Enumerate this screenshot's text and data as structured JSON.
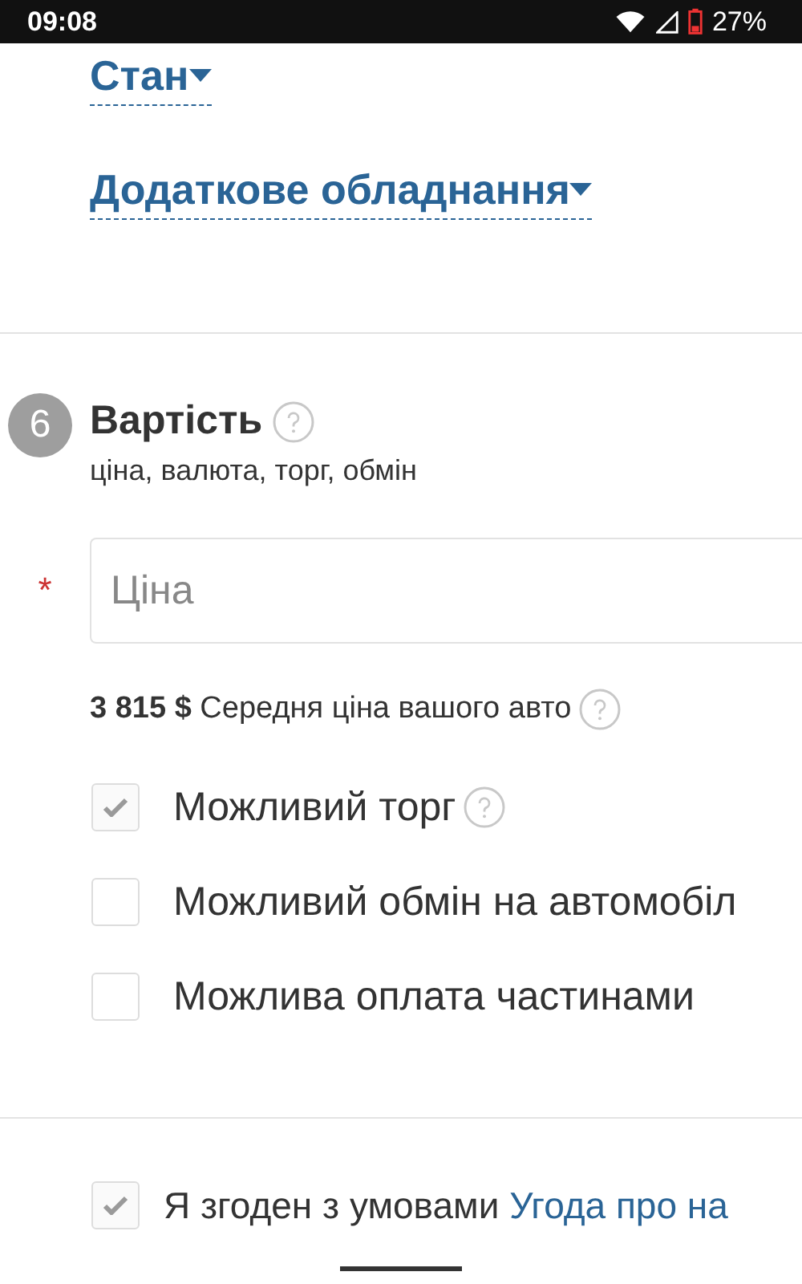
{
  "status_bar": {
    "time": "09:08",
    "battery": "27%"
  },
  "dropdowns": [
    {
      "label": "Стан"
    },
    {
      "label": "Додаткове обладнання"
    }
  ],
  "section": {
    "step": "6",
    "title": "Вартість",
    "subtitle": "ціна, валюта, торг, обмін"
  },
  "price_field": {
    "required_mark": "*",
    "placeholder": "Ціна"
  },
  "average_price": {
    "amount": "3 815 $",
    "text": "Середня ціна вашого авто"
  },
  "options": [
    {
      "label": "Можливий торг",
      "checked": true,
      "help": true
    },
    {
      "label": "Можливий обмін на автомобіл",
      "checked": false,
      "help": false
    },
    {
      "label": "Можлива оплата частинами",
      "checked": false,
      "help": false
    }
  ],
  "agreement": {
    "checked": true,
    "text": "Я згоден з умовами",
    "link": "Угода про на"
  }
}
